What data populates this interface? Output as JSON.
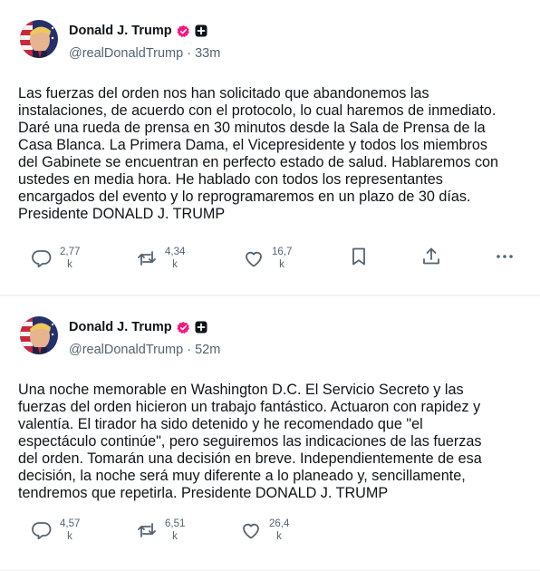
{
  "colors": {
    "text": "#0f1419",
    "secondary": "#536471",
    "verified_badge": "#f91880",
    "divider": "#eff3f4"
  },
  "posts": [
    {
      "author": {
        "display_name": "Donald J. Trump",
        "handle": "@realDonaldTrump",
        "time_ago": "33m",
        "avatar_icon": "avatar-image",
        "verified_icon": "verified-badge-icon",
        "extra_badge_icon": "plus-square-icon"
      },
      "text": "Las fuerzas del orden nos han solicitado que abandonemos las\ninstalaciones, de acuerdo con el protocolo, lo cual haremos de inmediato.\nDaré una rueda de prensa en 30 minutos desde la Sala de Prensa de la\nCasa Blanca. La Primera Dama, el Vicepresidente y todos los miembros\ndel Gabinete se encuentran en perfecto estado de salud. Hablaremos con\nustedes en media hora. He hablado con todos los representantes\nencargados del evento y lo reprogramaremos en un plazo de 30 días.\nPresidente DONALD J. TRUMP",
      "actions": {
        "replies": {
          "value": "2,77",
          "unit": "k",
          "icon": "reply-icon"
        },
        "reposts": {
          "value": "4,34",
          "unit": "k",
          "icon": "repost-icon"
        },
        "likes": {
          "value": "16,7",
          "unit": "k",
          "icon": "heart-icon"
        },
        "bookmark_icon": "bookmark-icon",
        "share_icon": "share-icon",
        "more_icon": "more-icon"
      }
    },
    {
      "author": {
        "display_name": "Donald J. Trump",
        "handle": "@realDonaldTrump",
        "time_ago": "52m",
        "avatar_icon": "avatar-image",
        "verified_icon": "verified-badge-icon",
        "extra_badge_icon": "plus-square-icon"
      },
      "text": "Una noche memorable en Washington D.C. El Servicio Secreto y las\nfuerzas del orden hicieron un trabajo fantástico. Actuaron con rapidez y\nvalentía. El tirador ha sido detenido y he recomendado que \"el\nespectáculo continúe\", pero seguiremos las indicaciones de las fuerzas\ndel orden. Tomarán una decisión en breve. Independientemente de esa\ndecisión, la noche será muy diferente a lo planeado y, sencillamente,\ntendremos que repetirla. Presidente DONALD J. TRUMP",
      "actions": {
        "replies": {
          "value": "4,57",
          "unit": "k",
          "icon": "reply-icon"
        },
        "reposts": {
          "value": "6,51",
          "unit": "k",
          "icon": "repost-icon"
        },
        "likes": {
          "value": "26,4",
          "unit": "k",
          "icon": "heart-icon"
        }
      }
    }
  ]
}
